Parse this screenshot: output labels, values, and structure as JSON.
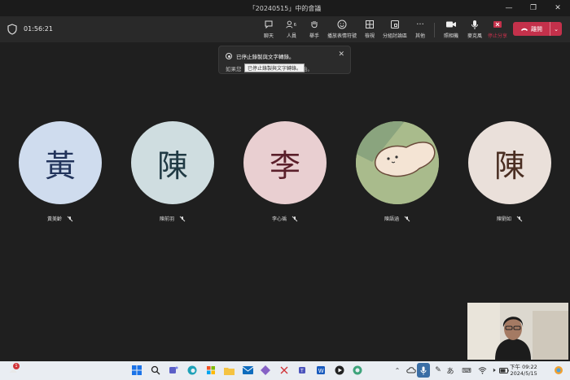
{
  "window": {
    "title": "「20240515」中的會議"
  },
  "toolbar": {
    "timer": "01:56:21",
    "buttons": [
      {
        "label": "聊天",
        "icon": "chat-icon"
      },
      {
        "label": "人員",
        "icon": "people-icon",
        "count": "6"
      },
      {
        "label": "舉手",
        "icon": "raise-hand-icon"
      },
      {
        "label": "播放表情符號",
        "icon": "emoji-icon"
      },
      {
        "label": "檢視",
        "icon": "view-icon"
      },
      {
        "label": "分組討論區",
        "icon": "breakout-rooms-icon"
      },
      {
        "label": "其他",
        "icon": "more-icon"
      },
      {
        "label": "照相機",
        "icon": "camera-icon"
      },
      {
        "label": "麥克風",
        "icon": "microphone-icon"
      },
      {
        "label": "停止分享",
        "icon": "stop-share-icon"
      }
    ],
    "leave_label": "離開"
  },
  "notice": {
    "title": "已停止錄製與文字轉錄。",
    "text": "如果您",
    "text_end": "開始。",
    "tooltip": "已停止錄製與文字轉錄。"
  },
  "participants": [
    {
      "initial": "黃",
      "name": "黃美齡",
      "bg": "#cfdcee",
      "fg": "#22345c"
    },
    {
      "initial": "陳",
      "name": "陳前羽",
      "bg": "#cfdde0",
      "fg": "#203a44"
    },
    {
      "initial": "李",
      "name": "李心瑀",
      "bg": "#e9cfd1",
      "fg": "#5a1f2a"
    },
    {
      "initial": "",
      "name": "陳語涵",
      "bg": "#9db37f",
      "fg": "#000000"
    },
    {
      "initial": "陳",
      "name": "陳劉如",
      "bg": "#eae0da",
      "fg": "#4a2e22"
    }
  ],
  "taskbar": {
    "notification_badge": "1",
    "clock_time": "下午 09:22",
    "clock_date": "2024/5/15",
    "ime": "あ"
  },
  "colors": {
    "leave": "#c4314b",
    "background": "#1f1f1f",
    "toolbar": "#292929"
  }
}
